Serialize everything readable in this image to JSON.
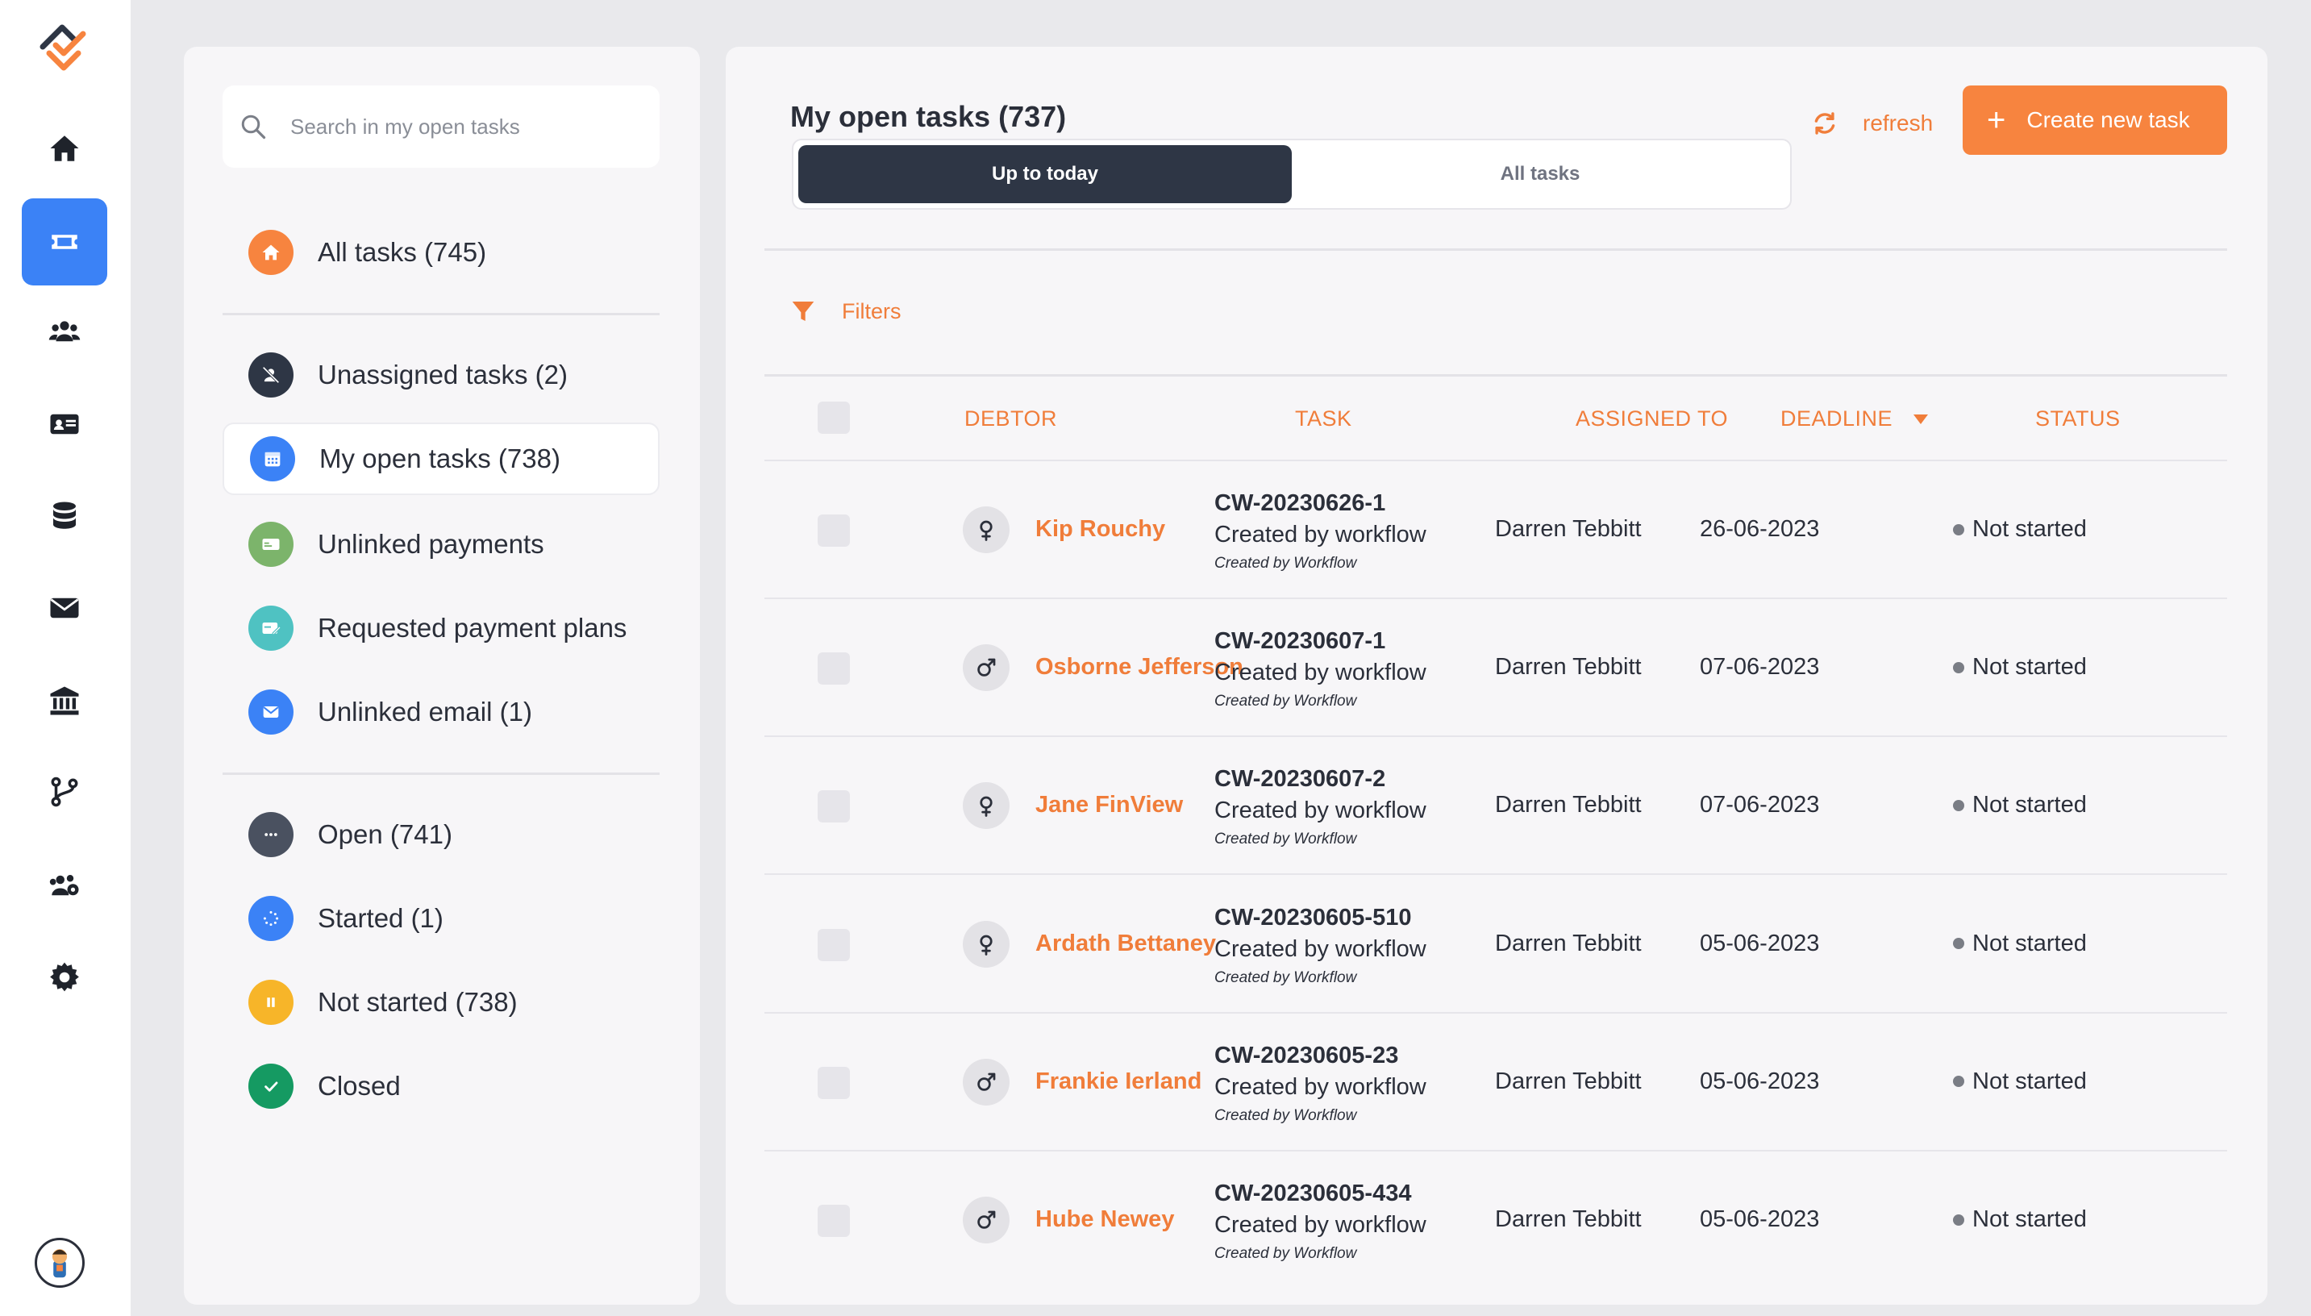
{
  "search": {
    "placeholder": "Search in my open tasks"
  },
  "nav_groups": {
    "all": {
      "label": "All tasks (745)"
    },
    "unassigned": {
      "label": "Unassigned tasks (2)"
    },
    "my_open": {
      "label": "My open tasks (738)"
    },
    "unlinked_payments": {
      "label": "Unlinked payments"
    },
    "payment_plans": {
      "label": "Requested payment plans"
    },
    "unlinked_email": {
      "label": "Unlinked email (1)"
    },
    "open": {
      "label": "Open (741)"
    },
    "started": {
      "label": "Started (1)"
    },
    "not_started": {
      "label": "Not started (738)"
    },
    "closed": {
      "label": "Closed"
    }
  },
  "main": {
    "title": "My open tasks (737)",
    "tabs": [
      "Up to today",
      "All tasks"
    ],
    "refresh_label": "refresh",
    "create_label": "Create new task",
    "filters_label": "Filters",
    "columns": {
      "debtor": "DEBTOR",
      "task": "TASK",
      "assigned": "ASSIGNED TO",
      "deadline": "DEADLINE",
      "status": "STATUS"
    }
  },
  "rows": [
    {
      "gender": "female",
      "debtor": "Kip Rouchy",
      "task_id": "CW-20230626-1",
      "task_title": "Created by workflow",
      "task_note": "Created by Workflow",
      "assigned_to": "Darren Tebbitt",
      "deadline": "26-06-2023",
      "status": "Not started"
    },
    {
      "gender": "male",
      "debtor": "Osborne Jefferson",
      "task_id": "CW-20230607-1",
      "task_title": "Created by workflow",
      "task_note": "Created by Workflow",
      "assigned_to": "Darren Tebbitt",
      "deadline": "07-06-2023",
      "status": "Not started"
    },
    {
      "gender": "female",
      "debtor": "Jane FinView",
      "task_id": "CW-20230607-2",
      "task_title": "Created by workflow",
      "task_note": "Created by Workflow",
      "assigned_to": "Darren Tebbitt",
      "deadline": "07-06-2023",
      "status": "Not started"
    },
    {
      "gender": "female",
      "debtor": "Ardath Bettaney",
      "task_id": "CW-20230605-510",
      "task_title": "Created by workflow",
      "task_note": "Created by Workflow",
      "assigned_to": "Darren Tebbitt",
      "deadline": "05-06-2023",
      "status": "Not started"
    },
    {
      "gender": "male",
      "debtor": "Frankie Ierland",
      "task_id": "CW-20230605-23",
      "task_title": "Created by workflow",
      "task_note": "Created by Workflow",
      "assigned_to": "Darren Tebbitt",
      "deadline": "05-06-2023",
      "status": "Not started"
    },
    {
      "gender": "male",
      "debtor": "Hube Newey",
      "task_id": "CW-20230605-434",
      "task_title": "Created by workflow",
      "task_note": "Created by Workflow",
      "assigned_to": "Darren Tebbitt",
      "deadline": "05-06-2023",
      "status": "Not started"
    }
  ],
  "colors": {
    "accent": "#f7843f",
    "active_rail": "#3b82f6",
    "segment_dark": "#2e3645"
  }
}
